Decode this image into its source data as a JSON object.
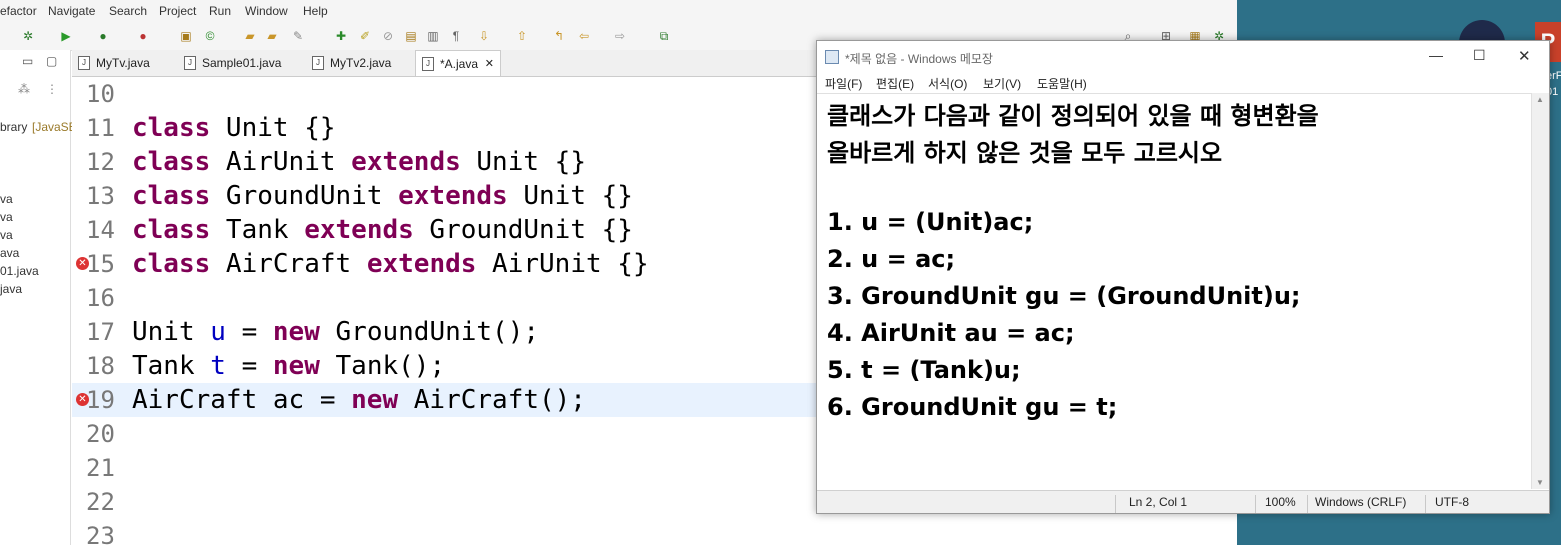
{
  "eclipse": {
    "menu": [
      "efactor",
      "Navigate",
      "Search",
      "Project",
      "Run",
      "Window",
      "Help"
    ],
    "tabs": [
      "MyTv.java",
      "Sample01.java",
      "MyTv2.java",
      "*A.java"
    ],
    "sidebar": [
      "brary",
      "[JavaSE",
      "va",
      "va",
      "va",
      "ava",
      "01.java",
      "java"
    ]
  },
  "code": {
    "line_numbers": [
      "10",
      "11",
      "12",
      "13",
      "14",
      "15",
      "16",
      "17",
      "18",
      "19",
      "20",
      "21",
      "22",
      "23"
    ]
  },
  "notepad": {
    "title": "*제목 없음 - Windows 메모장",
    "menu": [
      "파일(F)",
      "편집(E)",
      "서식(O)",
      "보기(V)",
      "도움말(H)"
    ],
    "lines": [
      "클래스가 다음과 같이 정의되어 있을 때 형변환을",
      "올바르게 하지 않은 것을 모두 고르시오",
      "",
      "1. u = (Unit)ac;",
      "2. u = ac;",
      "3. GroundUnit gu = (GroundUnit)u;",
      "4. AirUnit au = ac;",
      "5. t = (Tank)u;",
      "6. GroundUnit gu = t;"
    ],
    "status": {
      "position": "Ln 2, Col 1",
      "zoom": "100%",
      "eol": "Windows (CRLF)",
      "encoding": "UTF-8"
    }
  },
  "desktop": {
    "icon_text": "P",
    "fragment_1": "erF",
    "fragment_2": "01"
  }
}
